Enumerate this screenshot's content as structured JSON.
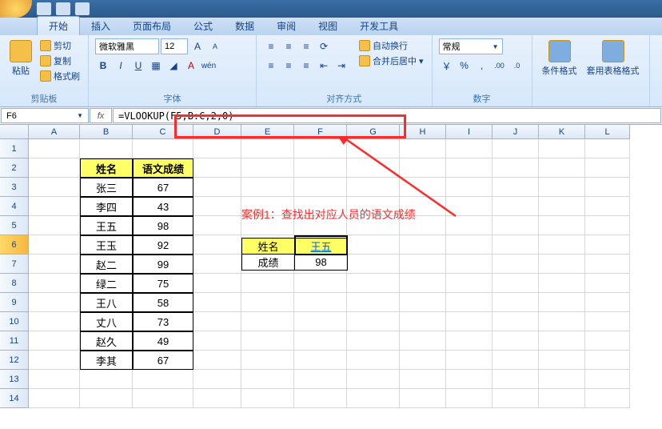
{
  "tabs": [
    "开始",
    "插入",
    "页面布局",
    "公式",
    "数据",
    "审阅",
    "视图",
    "开发工具"
  ],
  "active_tab": 0,
  "ribbon": {
    "clipboard": {
      "label": "剪贴板",
      "paste": "粘贴",
      "cut": "剪切",
      "copy": "复制",
      "painter": "格式刷"
    },
    "font": {
      "label": "字体",
      "name": "微软雅黑",
      "size": "12",
      "bold": "B",
      "italic": "I",
      "underline": "U"
    },
    "align": {
      "label": "对齐方式",
      "wrap": "自动换行",
      "merge": "合并后居中"
    },
    "number": {
      "label": "数字",
      "format": "常规"
    },
    "styles": {
      "cond": "条件格式",
      "table": "套用表格格式"
    }
  },
  "name_box": "F6",
  "formula": "=VLOOKUP(F5,B:C,2,0)",
  "columns": [
    "A",
    "B",
    "C",
    "D",
    "E",
    "F",
    "G",
    "H",
    "I",
    "J",
    "K",
    "L"
  ],
  "row_count": 14,
  "selected_row": 6,
  "table": {
    "headers": [
      "姓名",
      "语文成绩"
    ],
    "rows": [
      [
        "张三",
        "67"
      ],
      [
        "李四",
        "43"
      ],
      [
        "王五",
        "98"
      ],
      [
        "王玉",
        "92"
      ],
      [
        "赵二",
        "99"
      ],
      [
        "绿二",
        "75"
      ],
      [
        "王八",
        "58"
      ],
      [
        "丈八",
        "73"
      ],
      [
        "赵久",
        "49"
      ],
      [
        "李其",
        "67"
      ]
    ]
  },
  "callout": "案例1：查找出对应人员的语文成绩",
  "lookup": {
    "r1c1": "姓名",
    "r1c2": "王五",
    "r2c1": "成绩",
    "r2c2": "98"
  },
  "chart_data": {
    "type": "table",
    "title": "语文成绩",
    "columns": [
      "姓名",
      "语文成绩"
    ],
    "rows": [
      [
        "张三",
        67
      ],
      [
        "李四",
        43
      ],
      [
        "王五",
        98
      ],
      [
        "王玉",
        92
      ],
      [
        "赵二",
        99
      ],
      [
        "绿二",
        75
      ],
      [
        "王八",
        58
      ],
      [
        "丈八",
        73
      ],
      [
        "赵久",
        49
      ],
      [
        "李其",
        67
      ]
    ]
  }
}
